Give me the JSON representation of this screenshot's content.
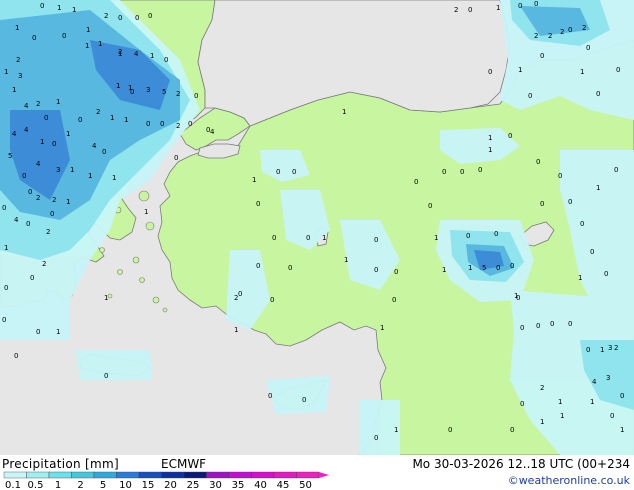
{
  "footer": {
    "title": "Precipitation [mm]",
    "model": "ECMWF",
    "datetime": "Mo 30-03-2026 12..18 UTC (00+234",
    "credit": "©weatheronline.co.uk"
  },
  "legend": {
    "labels": [
      "0.1",
      "0.5",
      "1",
      "2",
      "5",
      "10",
      "15",
      "20",
      "25",
      "30",
      "35",
      "40",
      "45",
      "50"
    ],
    "colors": [
      "#c8f5f8",
      "#a0eef2",
      "#70dfe8",
      "#44c8dc",
      "#34a8dc",
      "#2a7cd4",
      "#1a4fc0",
      "#10309a",
      "#0c1a78",
      "#9c14c8",
      "#c010d8",
      "#d80ec8",
      "#e818c0",
      "#f020c0"
    ]
  },
  "map_colors": {
    "sea": "#e6e6e6",
    "land_rain_free": "#c8f5a0",
    "precip_light": "#c8f5f8",
    "precip_moderate": "#90e4ee",
    "precip_heavy": "#58b8e0",
    "precip_heaviest": "#3c8cd8",
    "coastline": "#7a7a7a",
    "labels": "#000000"
  },
  "precip_values": [
    {
      "v": "0"
    },
    {
      "v": "1"
    },
    {
      "v": "1"
    },
    {
      "v": "2"
    },
    {
      "v": "0"
    },
    {
      "v": "1"
    },
    {
      "v": "0"
    },
    {
      "v": "1"
    },
    {
      "v": "2"
    },
    {
      "v": "4"
    },
    {
      "v": "1"
    },
    {
      "v": "0"
    },
    {
      "v": "2"
    },
    {
      "v": "1"
    },
    {
      "v": "3"
    },
    {
      "v": "5"
    },
    {
      "v": "3"
    },
    {
      "v": "1"
    },
    {
      "v": "1"
    },
    {
      "v": "2"
    },
    {
      "v": "0"
    },
    {
      "v": "1"
    },
    {
      "v": "4"
    },
    {
      "v": "1"
    },
    {
      "v": "2"
    },
    {
      "v": "1"
    },
    {
      "v": "1"
    },
    {
      "v": "4"
    },
    {
      "v": "2"
    },
    {
      "v": "4"
    },
    {
      "v": "1"
    },
    {
      "v": "5"
    },
    {
      "v": "4"
    },
    {
      "v": "3"
    },
    {
      "v": "1"
    },
    {
      "v": "1"
    },
    {
      "v": "2"
    },
    {
      "v": "2"
    },
    {
      "v": "1"
    },
    {
      "v": "4"
    },
    {
      "v": "0"
    },
    {
      "v": "2"
    },
    {
      "v": "0"
    },
    {
      "v": "0"
    },
    {
      "v": "1"
    },
    {
      "v": "2"
    },
    {
      "v": "0"
    },
    {
      "v": "1"
    },
    {
      "v": "0"
    },
    {
      "v": "0"
    },
    {
      "v": "1"
    },
    {
      "v": "0"
    },
    {
      "v": "2"
    },
    {
      "v": "1"
    },
    {
      "v": "0"
    },
    {
      "v": "0"
    },
    {
      "v": "1"
    },
    {
      "v": "0"
    },
    {
      "v": "0"
    },
    {
      "v": "1"
    },
    {
      "v": "0"
    },
    {
      "v": "0"
    },
    {
      "v": "0"
    },
    {
      "v": "1"
    },
    {
      "v": "0"
    },
    {
      "v": "0"
    },
    {
      "v": "1"
    },
    {
      "v": "0"
    },
    {
      "v": "0"
    },
    {
      "v": "0"
    },
    {
      "v": "0"
    },
    {
      "v": "1"
    },
    {
      "v": "1"
    },
    {
      "v": "0"
    },
    {
      "v": "0"
    },
    {
      "v": "1"
    },
    {
      "v": "5"
    },
    {
      "v": "0"
    },
    {
      "v": "0"
    },
    {
      "v": "1"
    },
    {
      "v": "0"
    },
    {
      "v": "2"
    },
    {
      "v": "0"
    },
    {
      "v": "1"
    },
    {
      "v": "0"
    },
    {
      "v": "0"
    },
    {
      "v": "0"
    },
    {
      "v": "1"
    },
    {
      "v": "0"
    },
    {
      "v": "0"
    },
    {
      "v": "1"
    },
    {
      "v": "0"
    },
    {
      "v": "0"
    },
    {
      "v": "2"
    },
    {
      "v": "0"
    },
    {
      "v": "2"
    },
    {
      "v": "1"
    },
    {
      "v": "0"
    },
    {
      "v": "0"
    },
    {
      "v": "0"
    },
    {
      "v": "0"
    },
    {
      "v": "1"
    },
    {
      "v": "0"
    },
    {
      "v": "0"
    },
    {
      "v": "0"
    },
    {
      "v": "0"
    },
    {
      "v": "0"
    },
    {
      "v": "0"
    },
    {
      "v": "1"
    },
    {
      "v": "0"
    },
    {
      "v": "0"
    },
    {
      "v": "1"
    },
    {
      "v": "0"
    },
    {
      "v": "0"
    },
    {
      "v": "0"
    },
    {
      "v": "0"
    },
    {
      "v": "0"
    },
    {
      "v": "1"
    },
    {
      "v": "2"
    },
    {
      "v": "2"
    },
    {
      "v": "3"
    },
    {
      "v": "4"
    },
    {
      "v": "2"
    },
    {
      "v": "0"
    },
    {
      "v": "2"
    },
    {
      "v": "3"
    },
    {
      "v": "0"
    },
    {
      "v": "0"
    },
    {
      "v": "1"
    },
    {
      "v": "0"
    },
    {
      "v": "0"
    },
    {
      "v": "1"
    },
    {
      "v": "0"
    },
    {
      "v": "0"
    },
    {
      "v": "0"
    },
    {
      "v": "1"
    },
    {
      "v": "1"
    },
    {
      "v": "0"
    },
    {
      "v": "0"
    },
    {
      "v": "0"
    },
    {
      "v": "1"
    },
    {
      "v": "1"
    },
    {
      "v": "1"
    },
    {
      "v": "0"
    },
    {
      "v": "0"
    },
    {
      "v": "0"
    },
    {
      "v": "0"
    },
    {
      "v": "0"
    },
    {
      "v": "1"
    },
    {
      "v": "0"
    },
    {
      "v": "0"
    },
    {
      "v": "4"
    },
    {
      "v": "0"
    },
    {
      "v": "0"
    },
    {
      "v": "0"
    },
    {
      "v": "1"
    },
    {
      "v": "2"
    },
    {
      "v": "0"
    },
    {
      "v": "1"
    },
    {
      "v": "1"
    },
    {
      "v": "0"
    },
    {
      "v": "0"
    },
    {
      "v": "0"
    },
    {
      "v": "0"
    },
    {
      "v": "1"
    },
    {
      "v": "0"
    },
    {
      "v": "4"
    },
    {
      "v": "0"
    },
    {
      "v": "1"
    }
  ]
}
